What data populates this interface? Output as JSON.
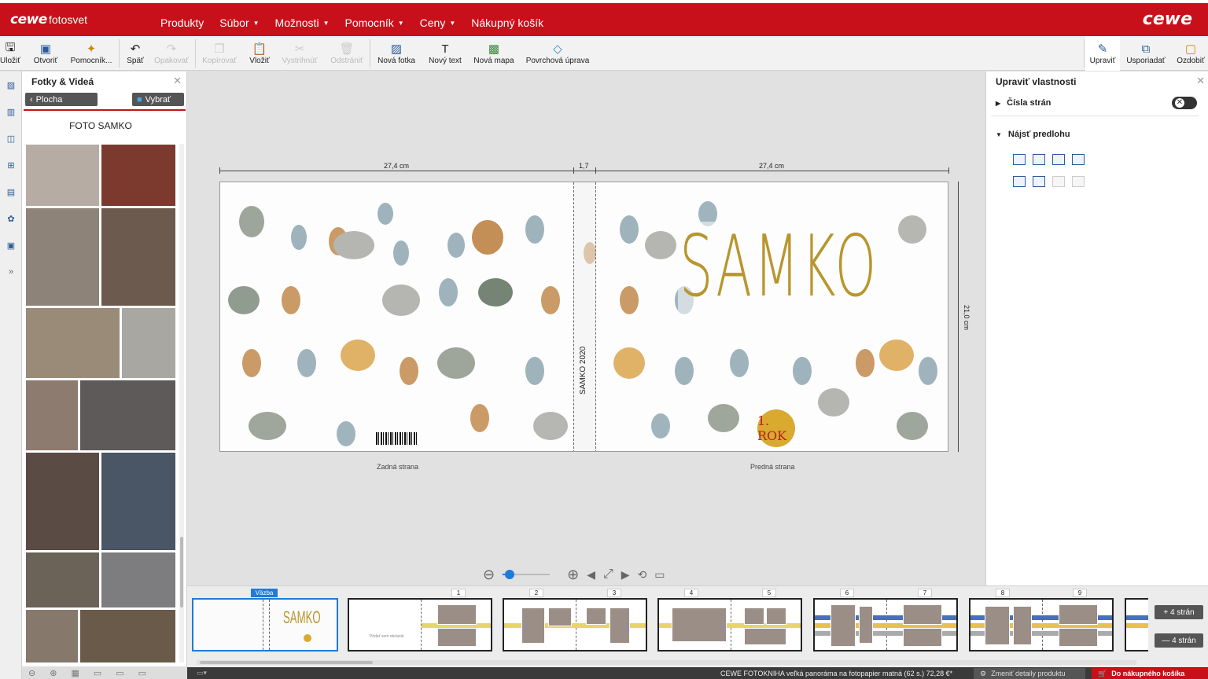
{
  "header": {
    "logo": "cewe",
    "brand": "fotosvet",
    "logo_right": "cewe",
    "menu": [
      {
        "label": "Produkty",
        "caret": false
      },
      {
        "label": "Súbor",
        "caret": true
      },
      {
        "label": "Možnosti",
        "caret": true
      },
      {
        "label": "Pomocník",
        "caret": true
      },
      {
        "label": "Ceny",
        "caret": true
      },
      {
        "label": "Nákupný košík",
        "caret": false
      }
    ]
  },
  "toolbar": {
    "save": "Uložiť",
    "open": "Otvoriť",
    "helper": "Pomocník...",
    "undo": "Späť",
    "redo": "Opakovať",
    "copy": "Kopírovať",
    "paste": "Vložiť",
    "cut": "Vystrihnúť",
    "delete": "Odstrániť",
    "new_photo": "Nová fotka",
    "new_text": "Nový text",
    "new_map": "Nová mapa",
    "surface": "Povrchová úprava",
    "edit": "Upraviť",
    "arrange": "Usporiadať",
    "decorate": "Ozdobiť"
  },
  "left_panel": {
    "title": "Fotky & Videá",
    "back_button": "Plocha",
    "select_button": "Vybrať",
    "album_name": "FOTO SAMKO"
  },
  "right_panel": {
    "title": "Upraviť vlastnosti",
    "page_numbers": "Čísla strán",
    "find_template": "Nájsť predlohu",
    "page_numbers_enabled": false
  },
  "canvas": {
    "dim_left": "27,4 cm",
    "dim_spine": "1,7",
    "dim_right": "27,4 cm",
    "dim_height": "21,0 cm",
    "cover_title": "SAMKO",
    "badge_text": "1. ROK",
    "spine_text": "SAMKO 2020",
    "back_label": "Zadná strana",
    "front_label": "Predná strana"
  },
  "zoom": {
    "level": 0.05
  },
  "strip": {
    "cover_label": "Väzba",
    "cover_title": "SAMKO",
    "page_numbers": [
      "1",
      "2",
      "3",
      "4",
      "5",
      "6",
      "7",
      "8",
      "9"
    ],
    "add_pages": "+ 4 strán",
    "remove_pages": "— 4 strán",
    "placeholder_text": "Pridať sem obrázok"
  },
  "status": {
    "product": "CEWE FOTOKNIHA veľká panoráma na fotopapier matná (62 s.) 72,28 €*",
    "change_details": "Zmeniť detaily produktu",
    "to_cart": "Do nákupného košíka"
  },
  "colors": {
    "brand_red": "#c8101a",
    "accent_blue": "#1f7bd8",
    "title_gold": "#b8962e"
  }
}
